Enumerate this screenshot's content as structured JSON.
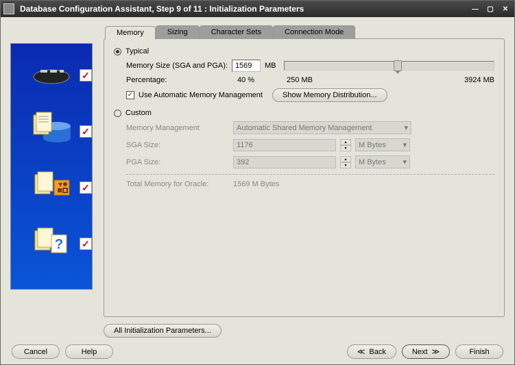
{
  "titlebar": {
    "title": "Database Configuration Assistant, Step 9 of 11 : Initialization Parameters"
  },
  "tabs": {
    "memory": "Memory",
    "sizing": "Sizing",
    "charsets": "Character Sets",
    "connmode": "Connection Mode"
  },
  "memory": {
    "typical_label": "Typical",
    "size_label": "Memory Size (SGA and PGA):",
    "size_value": "1569",
    "size_unit": "MB",
    "percentage_label": "Percentage:",
    "percentage_value": "40 %",
    "slider_min": "250 MB",
    "slider_max": "3924 MB",
    "auto_mm_label": "Use Automatic Memory Management",
    "show_dist_btn": "Show Memory Distribution...",
    "custom_label": "Custom",
    "mm_label": "Memory Management",
    "mm_value": "Automatic Shared Memory Management",
    "sga_label": "SGA Size:",
    "sga_value": "1176",
    "sga_unit": "M Bytes",
    "pga_label": "PGA Size:",
    "pga_value": "392",
    "pga_unit": "M Bytes",
    "total_label": "Total Memory for Oracle:",
    "total_value": "1569 M Bytes"
  },
  "buttons": {
    "all_params": "All Initialization Parameters...",
    "cancel": "Cancel",
    "help": "Help",
    "back": "Back",
    "next": "Next",
    "finish": "Finish"
  }
}
